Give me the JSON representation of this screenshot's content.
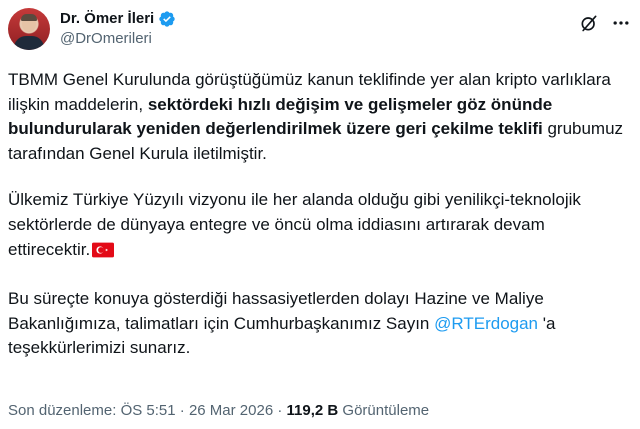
{
  "author": {
    "display_name": "Dr. Ömer İleri",
    "handle": "@DrOmerileri",
    "verified": true
  },
  "tweet": {
    "p1_part1": "TBMM Genel Kurulunda görüştüğümüz kanun teklifinde yer alan kripto varlıklara ilişkin maddelerin, ",
    "p1_bold": "sektördeki hızlı değişim ve gelişmeler göz önünde bulundurularak yeniden değerlendirilmek üzere geri çekilme teklifi",
    "p1_part2": " grubumuz tarafından Genel Kurula iletilmiştir.",
    "p2": "Ülkemiz Türkiye Yüzyılı vizyonu ile her alanda olduğu gibi yenilikçi-teknolojik sektörlerde de dünyaya entegre ve öncü olma iddiasını artırarak devam ettirecektir.",
    "p3_part1": "Bu süreçte konuya gösterdiği hassasiyetlerden dolayı Hazine ve Maliye Bakanlığımıza, talimatları için Cumhurbaşkanımız Sayın ",
    "p3_mention": "@RTErdogan",
    "p3_part2": " 'a teşekkürlerimizi sunarız."
  },
  "meta": {
    "edited_label": "Son düzenleme: ÖS 5:51",
    "separator": "·",
    "date": "26 Mar 2026",
    "views_count": "119,2 B",
    "views_label": "Görüntüleme"
  },
  "icons": {
    "grok": "grok-icon",
    "more": "more-icon",
    "verified": "verified-badge-icon",
    "flag": "turkey-flag-icon"
  },
  "colors": {
    "accent": "#1d9bf0",
    "secondary_text": "#536471",
    "flag_red": "#e30a17"
  }
}
